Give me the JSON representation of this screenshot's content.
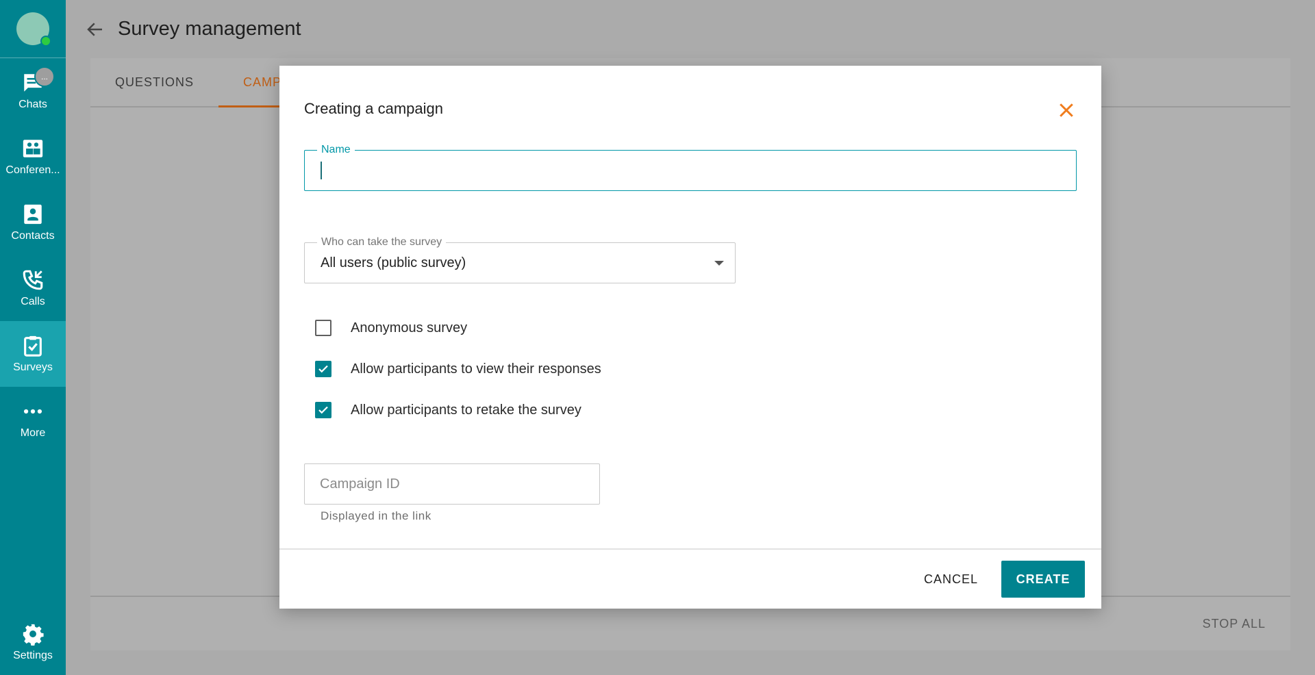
{
  "header": {
    "title": "Survey management"
  },
  "sidebar": {
    "badge": "...",
    "items": [
      {
        "label": "Chats"
      },
      {
        "label": "Conferen..."
      },
      {
        "label": "Contacts"
      },
      {
        "label": "Calls"
      },
      {
        "label": "Surveys"
      },
      {
        "label": "More"
      }
    ],
    "settings_label": "Settings"
  },
  "main": {
    "tabs": [
      {
        "label": "QUESTIONS"
      },
      {
        "label": "CAMP"
      }
    ],
    "stop_all": "STOP ALL"
  },
  "modal": {
    "title": "Creating a campaign",
    "name_field": {
      "label": "Name",
      "value": ""
    },
    "audience": {
      "label": "Who can take the survey",
      "value": "All users (public survey)"
    },
    "checkboxes": [
      {
        "label": "Anonymous survey",
        "checked": false
      },
      {
        "label": "Allow participants to view their responses",
        "checked": true
      },
      {
        "label": "Allow participants to retake the survey",
        "checked": true
      }
    ],
    "campaign_id": {
      "placeholder": "Campaign ID",
      "helper": "Displayed in the link"
    },
    "cancel_label": "CANCEL",
    "create_label": "CREATE"
  },
  "colors": {
    "accent": "#00838f",
    "tab_active": "#c05e14",
    "close": "#f07c1c"
  }
}
